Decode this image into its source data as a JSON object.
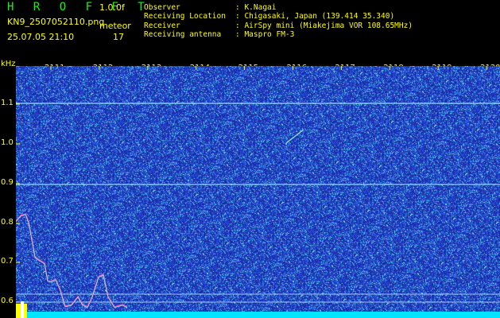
{
  "header": {
    "title": "H R O F F T",
    "version": "1.0.0f",
    "filename": "KN9_2507052110.png",
    "mode": "meteor",
    "datetime": "25.07.05 21:10",
    "count": "17",
    "observer_label": "Observer",
    "observer_value": ": K.Nagai",
    "location_label": "Receiving Location",
    "location_value": ": Chigasaki, Japan (139.414 35.340)",
    "receiver_label": "Receiver",
    "receiver_value": ": AirSpy mini (Miakejima VOR 108.65MHz)",
    "antenna_label": "Receiving antenna",
    "antenna_value": ": Maspro FM-3"
  },
  "axes": {
    "unit": "kHz",
    "x_ticks": [
      "2111",
      "2112",
      "2113",
      "2114",
      "2115",
      "2116",
      "2117",
      "2118",
      "2119",
      "2120"
    ],
    "y_ticks": [
      "1.1",
      "1.0",
      "0.9",
      "0.8",
      "0.7",
      "0.6"
    ]
  },
  "colors": {
    "background": "#1a2a9c",
    "grid_tick": "#ffff00",
    "signal_line": "#9ff0ff",
    "baseline": "#00e5ff",
    "text": "#ffff00",
    "title": "#00ff00"
  }
}
